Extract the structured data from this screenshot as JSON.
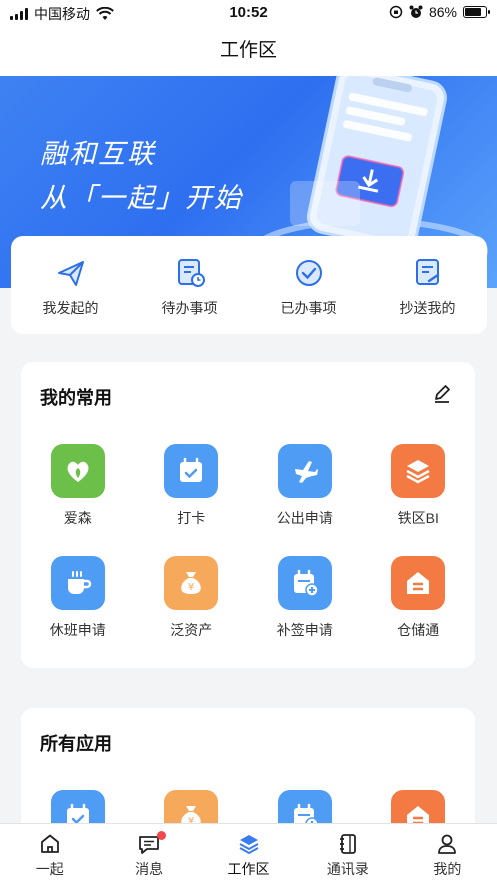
{
  "status_bar": {
    "carrier": "中国移动",
    "time": "10:52",
    "battery": "86%",
    "battery_level": 0.86
  },
  "nav": {
    "title": "工作区"
  },
  "banner": {
    "line1": "融和互联",
    "line2": "从「一起」开始"
  },
  "quick_actions": [
    {
      "label": "我发起的",
      "icon": "send-icon"
    },
    {
      "label": "待办事项",
      "icon": "pending-icon"
    },
    {
      "label": "已办事项",
      "icon": "done-icon"
    },
    {
      "label": "抄送我的",
      "icon": "cc-icon"
    }
  ],
  "common": {
    "title": "我的常用",
    "apps": [
      {
        "label": "爱森",
        "icon": "heart-leaf-icon",
        "color": "#6cc04a"
      },
      {
        "label": "打卡",
        "icon": "calendar-check-icon",
        "color": "#4f9cf5"
      },
      {
        "label": "公出申请",
        "icon": "airplane-icon",
        "color": "#4f9cf5"
      },
      {
        "label": "铁区BI",
        "icon": "layers-icon",
        "color": "#f47a43"
      },
      {
        "label": "休班申请",
        "icon": "cup-icon",
        "color": "#4f9cf5"
      },
      {
        "label": "泛资产",
        "icon": "money-bag-icon",
        "color": "#f6a85b"
      },
      {
        "label": "补签申请",
        "icon": "calendar-plus-icon",
        "color": "#4f9cf5"
      },
      {
        "label": "仓储通",
        "icon": "warehouse-icon",
        "color": "#f47a43"
      }
    ]
  },
  "all_apps": {
    "title": "所有应用",
    "apps": [
      {
        "label": "",
        "icon": "calendar-check-icon",
        "color": "#4f9cf5"
      },
      {
        "label": "",
        "icon": "money-bag-icon",
        "color": "#f6a85b"
      },
      {
        "label": "",
        "icon": "calendar-plus-icon",
        "color": "#4f9cf5"
      },
      {
        "label": "",
        "icon": "warehouse-icon",
        "color": "#f47a43"
      }
    ]
  },
  "tabs": [
    {
      "label": "一起",
      "icon": "home-icon"
    },
    {
      "label": "消息",
      "icon": "message-icon",
      "badge": true
    },
    {
      "label": "工作区",
      "icon": "layers-icon",
      "active": true
    },
    {
      "label": "通讯录",
      "icon": "contacts-icon"
    },
    {
      "label": "我的",
      "icon": "person-icon"
    }
  ]
}
